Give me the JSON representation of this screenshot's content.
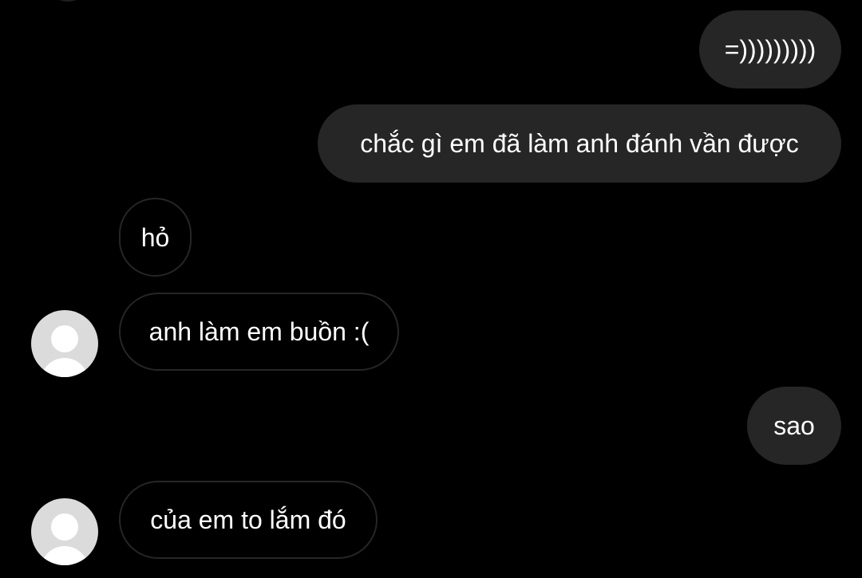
{
  "conversation": {
    "messages": [
      {
        "sender": "self",
        "text": "=)))))))))"
      },
      {
        "sender": "self",
        "text": "chắc gì em đã làm anh đánh vần được"
      },
      {
        "sender": "other",
        "text": "hỏ"
      },
      {
        "sender": "other",
        "text": "anh làm em buồn :("
      },
      {
        "sender": "self",
        "text": "sao"
      },
      {
        "sender": "other",
        "text": "của em to lắm đó"
      }
    ]
  },
  "colors": {
    "background": "#000000",
    "sent_bubble": "#262626",
    "received_border": "#262626",
    "text": "#ffffff",
    "avatar_placeholder": "#dbdbdb"
  },
  "icons": {
    "avatar": "default-user-avatar-icon"
  }
}
